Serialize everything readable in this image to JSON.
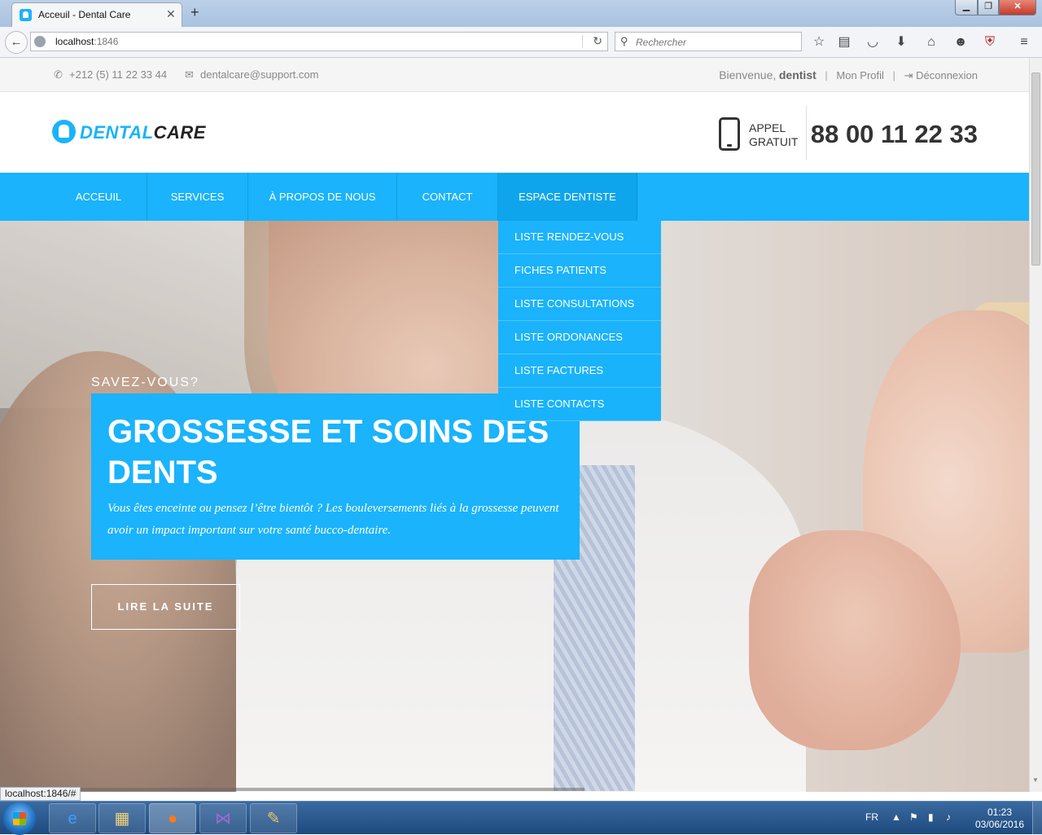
{
  "browser": {
    "tab_title": "Acceuil - Dental Care",
    "tab_close": "✕",
    "new_tab": "+",
    "url_host": "localhost",
    "url_port": ":1846",
    "search_placeholder": "Rechercher",
    "status_url": "localhost:1846/#"
  },
  "topbar": {
    "phone": "+212 (5) 11 22 33 44",
    "email": "dentalcare@support.com",
    "welcome": "Bienvenue,",
    "username": "dentist",
    "profile": "Mon Profil",
    "logout": "Déconnexion"
  },
  "header": {
    "logo_part1": "DENTAL",
    "logo_part2": "CARE",
    "call_line1": "APPEL",
    "call_line2": "GRATUIT",
    "call_number": "88 00 11 22 33"
  },
  "nav": {
    "items": [
      "ACCEUIL",
      "SERVICES",
      "À PROPOS DE NOUS",
      "CONTACT",
      "ESPACE DENTISTE"
    ]
  },
  "dropdown": {
    "items": [
      "LISTE RENDEZ-VOUS",
      "FICHES PATIENTS",
      "LISTE CONSULTATIONS",
      "LISTE ORDONANCES",
      "LISTE FACTURES",
      "LISTE CONTACTS"
    ]
  },
  "hero": {
    "kicker": "SAVEZ-VOUS?",
    "title": "GROSSESSE ET SOINS DES DENTS",
    "text": "Vous êtes enceinte ou pensez l’être bientôt ? Les bouleversements liés à la grossesse peuvent avoir un impact important sur votre santé bucco-dentaire.",
    "button": "LIRE LA SUITE"
  },
  "taskbar": {
    "lang": "FR",
    "time": "01:23",
    "date": "03/06/2016"
  },
  "colors": {
    "accent": "#1ab3fc",
    "dark": "#333333"
  }
}
